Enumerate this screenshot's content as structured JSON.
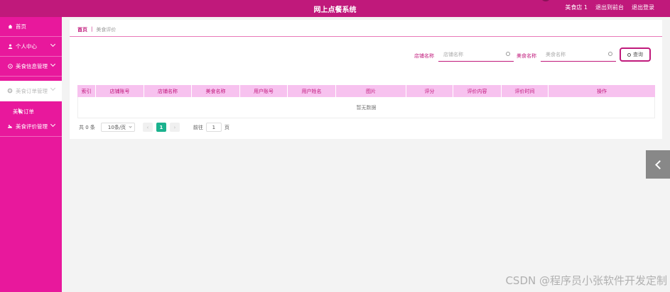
{
  "app": {
    "title": "网上点餐系统",
    "user_label": "美食店 1",
    "exit_to_front": "退出到前台",
    "logout": "退出登录"
  },
  "sidebar": {
    "items": [
      {
        "label": "首页",
        "icon": "home-icon"
      },
      {
        "label": "个人中心",
        "icon": "user-icon"
      },
      {
        "label": "美食信息管理",
        "icon": "info-icon"
      },
      {
        "label": "美食订单管理",
        "icon": "order-icon",
        "state": "hover"
      },
      {
        "label": "美食评价管理",
        "icon": "review-icon"
      }
    ],
    "subitems": [
      "美食订单"
    ]
  },
  "breadcrumb": {
    "home": "首页",
    "separator": "|",
    "current": "美食评价"
  },
  "search": {
    "shop_name_label": "店铺名称",
    "shop_name_placeholder": "店铺名称",
    "food_name_label": "美食名称",
    "food_name_placeholder": "美食名称",
    "query_button": "查询"
  },
  "table": {
    "columns": [
      "索引",
      "店铺账号",
      "店铺名称",
      "美食名称",
      "用户账号",
      "用户姓名",
      "图片",
      "评分",
      "评价内容",
      "评价时间",
      "操作"
    ],
    "empty_text": "暂无数据"
  },
  "pagination": {
    "total": "共 0 条",
    "page_size": "10条/页",
    "prev": "‹",
    "current_page": "1",
    "next": "›",
    "goto_label": "前往",
    "goto_value": "1",
    "goto_suffix": "页"
  },
  "watermark": "CSDN @程序员小张软件开发定制",
  "colors": {
    "topbar": "#c0197b",
    "sidebar": "#e8189c",
    "accent": "#c0197b",
    "table_header": "#f7c2ef",
    "active_page": "#1bb28e"
  }
}
